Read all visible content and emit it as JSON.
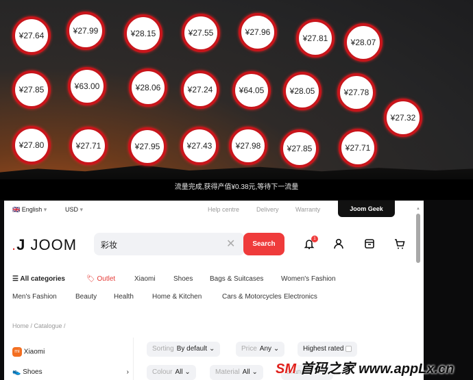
{
  "coins": [
    "¥27.64",
    "¥27.99",
    "¥28.15",
    "¥27.55",
    "¥27.96",
    "¥27.81",
    "¥28.07",
    "¥27.85",
    "¥63.00",
    "¥28.06",
    "¥27.24",
    "¥64.05",
    "¥28.05",
    "¥27.78",
    "¥27.32",
    "¥27.80",
    "¥27.71",
    "¥27.95",
    "¥27.43",
    "¥27.98",
    "¥27.85",
    "¥27.71"
  ],
  "banner": "流量完成,获得产值¥0.38元,等待下一流量",
  "topbar": {
    "language": "English",
    "currency": "USD",
    "help": "Help centre",
    "delivery": "Delivery",
    "warranty": "Warranty",
    "geek": "Joom Geek"
  },
  "header": {
    "logo": "JOOM",
    "search_value": "彩妆",
    "search_button": "Search",
    "notification_count": "1"
  },
  "nav_row1": [
    "All categories",
    "Outlet",
    "Xiaomi",
    "Shoes",
    "Bags & Suitcases",
    "Women's Fashion"
  ],
  "nav_row2": [
    "Men's Fashion",
    "Beauty",
    "Health",
    "Home & Kitchen",
    "Cars & Motorcycles",
    "Electronics"
  ],
  "breadcrumb": "Home / Catalogue /",
  "sidebar": [
    {
      "label": "Xiaomi"
    },
    {
      "label": "Shoes"
    }
  ],
  "filters": {
    "sorting_label": "Sorting",
    "sorting_value": "By default",
    "price_label": "Price",
    "price_value": "Any",
    "highest_rated": "Highest rated",
    "colour_label": "Colour",
    "colour_value": "All",
    "material_label": "Material",
    "material_value": "All",
    "brand_label": "Brand"
  },
  "watermark": {
    "mark": "SM",
    "text": "首码之家 www.appLx.cn"
  },
  "colors": {
    "accent": "#ef3b3b",
    "coin_ring": "#c8151b"
  }
}
